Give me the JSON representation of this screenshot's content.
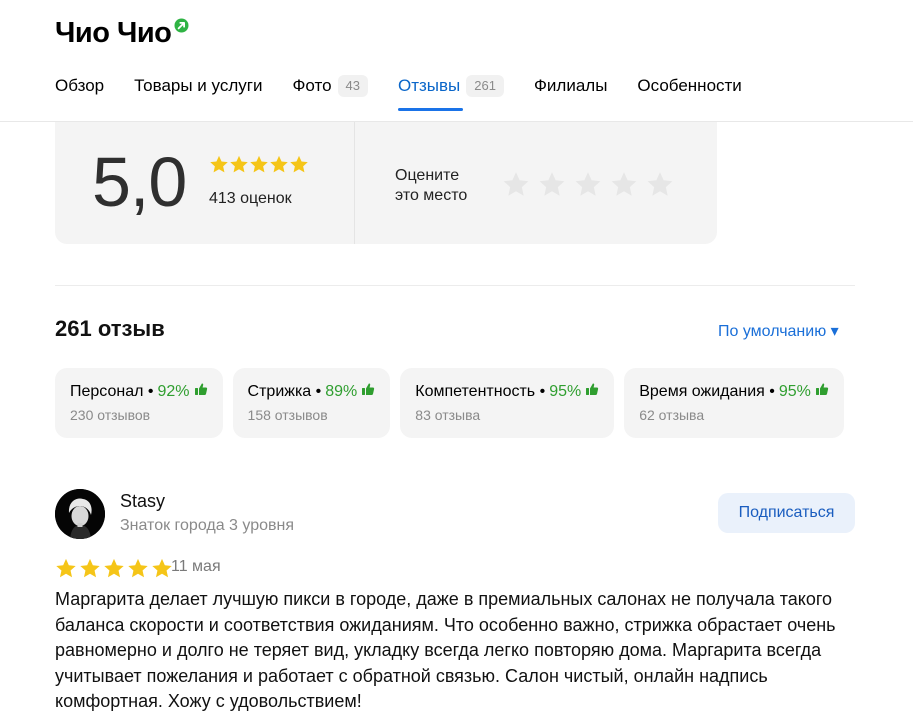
{
  "header": {
    "title": "Чио Чио",
    "verified_icon": "verified-arrow-icon",
    "tabs": [
      {
        "label": "Обзор",
        "count": ""
      },
      {
        "label": "Товары и услуги",
        "count": ""
      },
      {
        "label": "Фото",
        "count": "43"
      },
      {
        "label": "Отзывы",
        "count": "261"
      },
      {
        "label": "Филиалы",
        "count": ""
      },
      {
        "label": "Особенности",
        "count": ""
      }
    ],
    "active_tab": "Отзывы"
  },
  "rating": {
    "value": "5,0",
    "stars_filled": 5,
    "count_text": "413 оценок",
    "rate_prompt_line1": "Оцените",
    "rate_prompt_line2": "это место"
  },
  "reviews": {
    "count_title": "261 отзыв",
    "sort_label": "По умолчанию ▾"
  },
  "aspects": [
    {
      "name": "Персонал •",
      "percent": "92%",
      "reviews": "230 отзывов"
    },
    {
      "name": "Стрижка •",
      "percent": "89%",
      "reviews": "158 отзывов"
    },
    {
      "name": "Компетентность •",
      "percent": "95%",
      "reviews": "83 отзыва"
    },
    {
      "name": "Время ожидания •",
      "percent": "95%",
      "reviews": "62 отзыва"
    }
  ],
  "review": {
    "author": "Stasy",
    "level": "Знаток города 3 уровня",
    "subscribe_label": "Подписаться",
    "stars": 5,
    "date": "11 мая",
    "text": "Маргарита делает лучшую пикси в городе, даже в премиальных салонах не получала такого баланса скорости и соответствия ожиданиям. Что особенно важно, стрижка обрастает очень равномерно и долго не теряет вид, укладку всегда легко повторяю дома. Маргарита всегда учитывает пожелания и работает с обратной связью. Салон чистый, онлайн надпись комфортная. Хожу с удовольствием!"
  },
  "colors": {
    "accent": "#1a73e8",
    "star_gold": "#f5c518",
    "star_empty": "#e6e6e6",
    "positive": "#2f9e2f"
  }
}
